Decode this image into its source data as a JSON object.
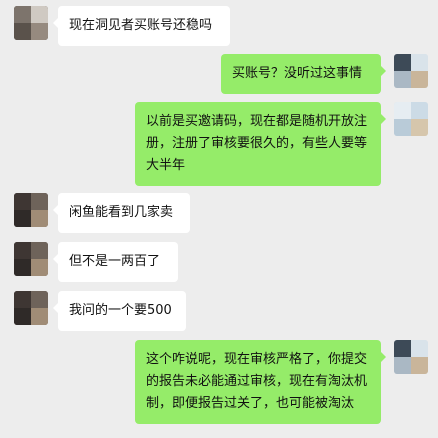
{
  "messages": [
    {
      "side": "left",
      "text": "现在洞见者买账号还稳吗"
    },
    {
      "side": "right",
      "text": "买账号？没听过这事情"
    },
    {
      "side": "right",
      "text": "以前是买邀请码，现在都是随机开放注册，注册了审核要很久的，有些人要等大半年"
    },
    {
      "side": "left",
      "text": "闲鱼能看到几家卖"
    },
    {
      "side": "left",
      "text": "但不是一两百了"
    },
    {
      "side": "left",
      "text": "我问的一个要500"
    },
    {
      "side": "right",
      "text": "这个咋说呢，现在审核严格了，你提交的报告未必能通过审核，现在有淘汰机制，即便报告过关了，也可能被淘汰"
    }
  ],
  "colors": {
    "background": "#ededed",
    "incoming_bubble": "#ffffff",
    "outgoing_bubble": "#95ec69",
    "text": "#111111"
  },
  "icons": {
    "left_avatar": "contact-avatar-icon",
    "right_avatar": "self-avatar-icon"
  }
}
